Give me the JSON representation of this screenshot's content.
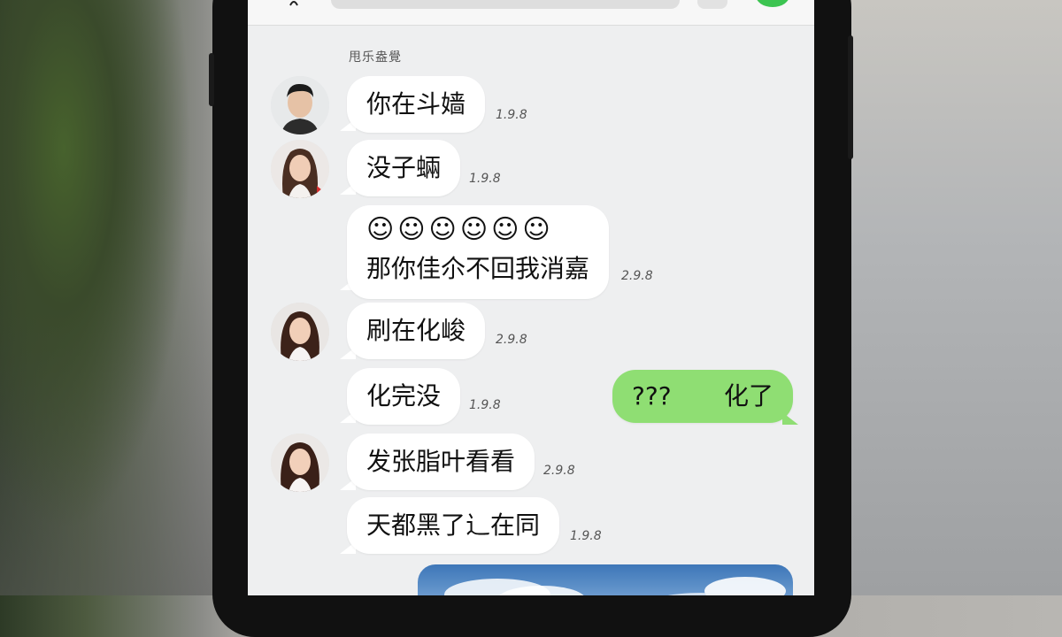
{
  "header": {
    "time": "甩乐盎覺"
  },
  "messages": [
    {
      "text": "你在斗嫱",
      "time": "1.9.8"
    },
    {
      "text": "没子蜽",
      "time": "1.9.8"
    },
    {
      "emojis": "☺☺☺☺☺☺",
      "text": "那你佳尒不回我消嘉",
      "time": "2.9.8"
    },
    {
      "text": "刷在化峻",
      "time": "2.9.8"
    },
    {
      "text": "化完没",
      "time": "1.9.8"
    },
    {
      "text_a": "???",
      "text_b": "化了"
    },
    {
      "text": "发张脂叶看看",
      "time": "2.9.8"
    },
    {
      "text": "天都黑了辶在同",
      "time": "1.9.8"
    }
  ],
  "colors": {
    "outgoing": "#8fde73",
    "incoming": "#ffffff",
    "chat_bg": "#eeeff0"
  }
}
